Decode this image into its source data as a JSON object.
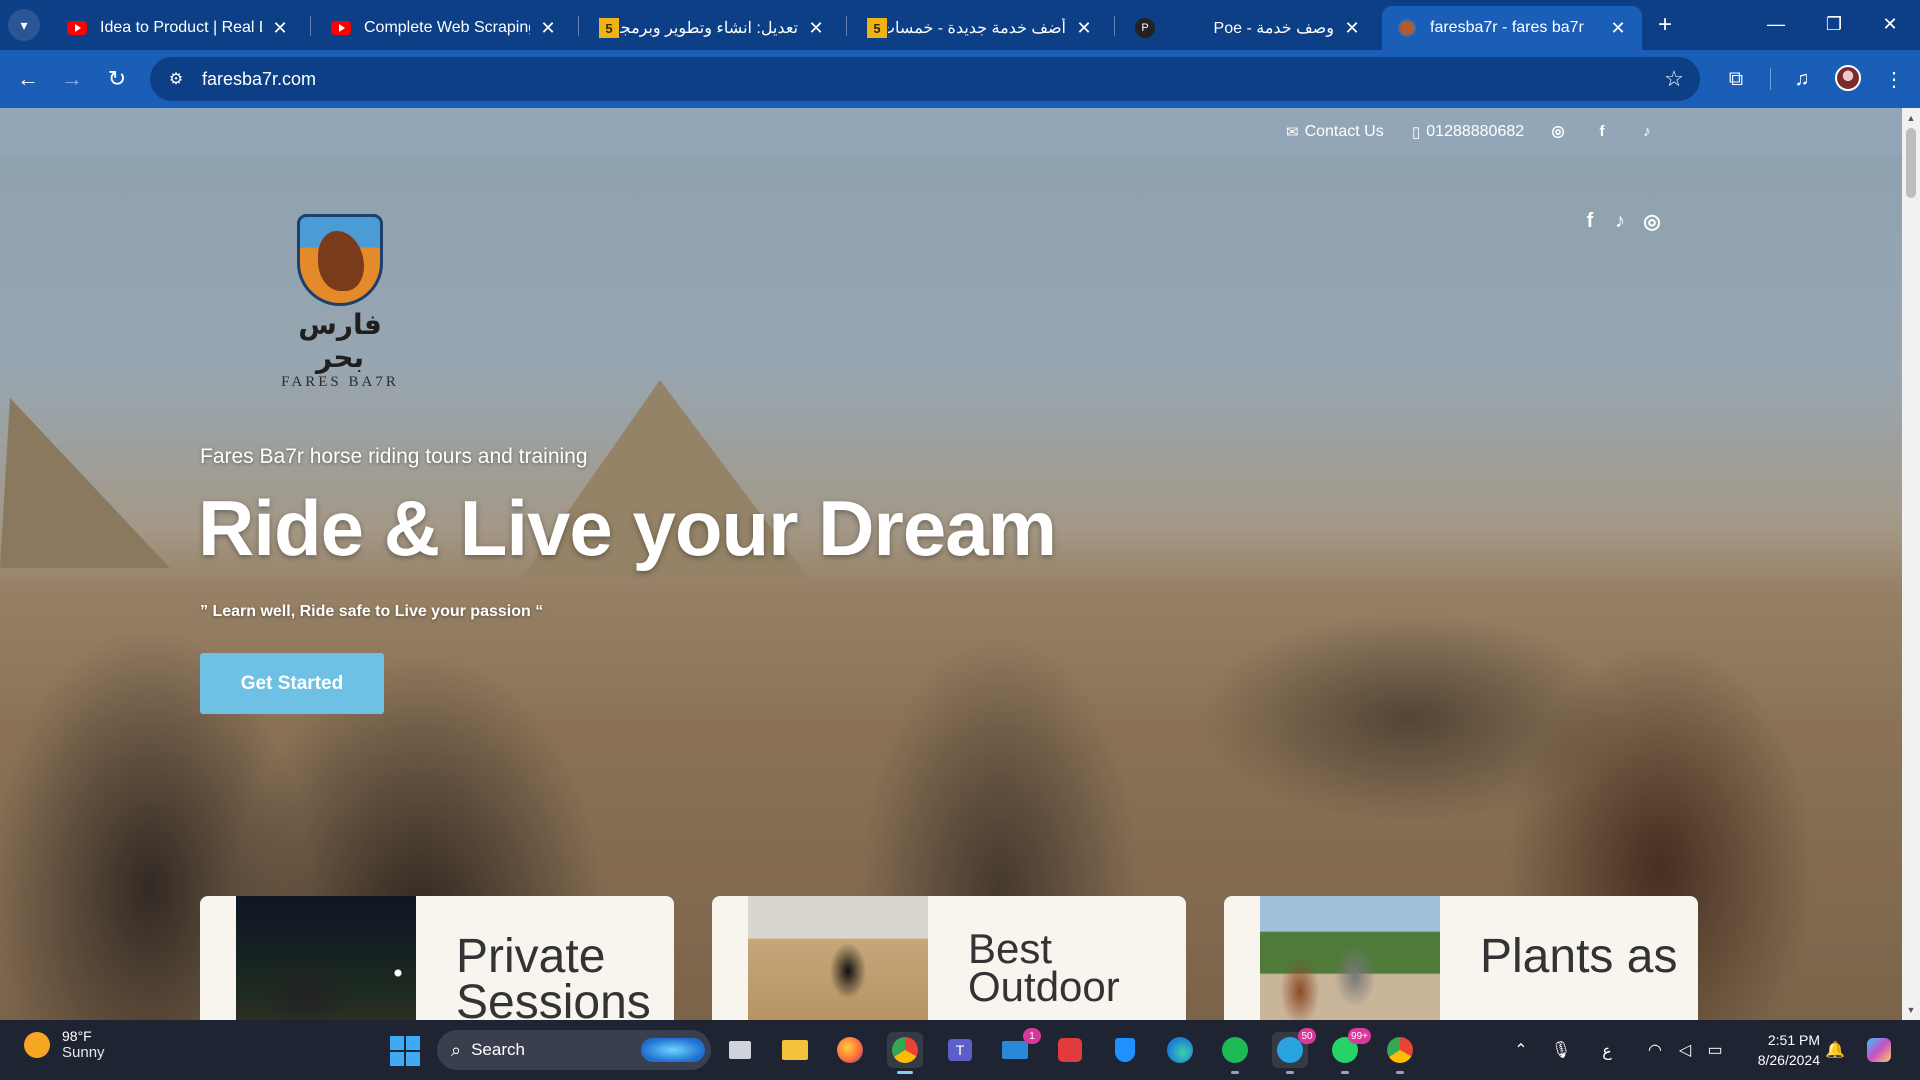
{
  "browser": {
    "tabs": [
      {
        "title": "Idea to Product | Real Djan",
        "favicon": "youtube-icon"
      },
      {
        "title": "Complete Web Scraping C",
        "favicon": "youtube-icon"
      },
      {
        "title": "تعديل: انشاء وتطوير وبرمجة",
        "favicon": "khamsat-icon"
      },
      {
        "title": "أضف خدمة جديدة - خمسات",
        "favicon": "khamsat-icon"
      },
      {
        "title": "Poe - وصف خدمة",
        "favicon": "poe-icon"
      },
      {
        "title": "faresba7r - fares ba7r",
        "favicon": "site-horse-icon"
      }
    ],
    "favicon_text": {
      "khamsat": "5",
      "poe": "P"
    },
    "url": "faresba7r.com"
  },
  "page": {
    "contact_label": "Contact Us",
    "phone": "01288880682",
    "logo_arabic": "فارس بحر",
    "logo_english": "FARES BA7R",
    "hero_subtitle": "Fares Ba7r horse riding tours and training",
    "hero_title": "Ride & Live your Dream",
    "hero_quote": "” Learn well, Ride safe to Live your passion “",
    "cta_label": "Get Started",
    "cards": [
      {
        "title": "Private Sessions"
      },
      {
        "title": "Best Outdoor"
      },
      {
        "title": "Plants as"
      }
    ],
    "colors": {
      "cta": "#6ec1e4",
      "chrome": "#1a5eb8"
    }
  },
  "taskbar": {
    "weather_temp": "98°F",
    "weather_desc": "Sunny",
    "search_label": "Search",
    "mail_badge": "1",
    "telegram_badge": "50",
    "whatsapp_badge": "99+",
    "lang": "ع",
    "time": "2:51 PM",
    "date": "8/26/2024"
  }
}
